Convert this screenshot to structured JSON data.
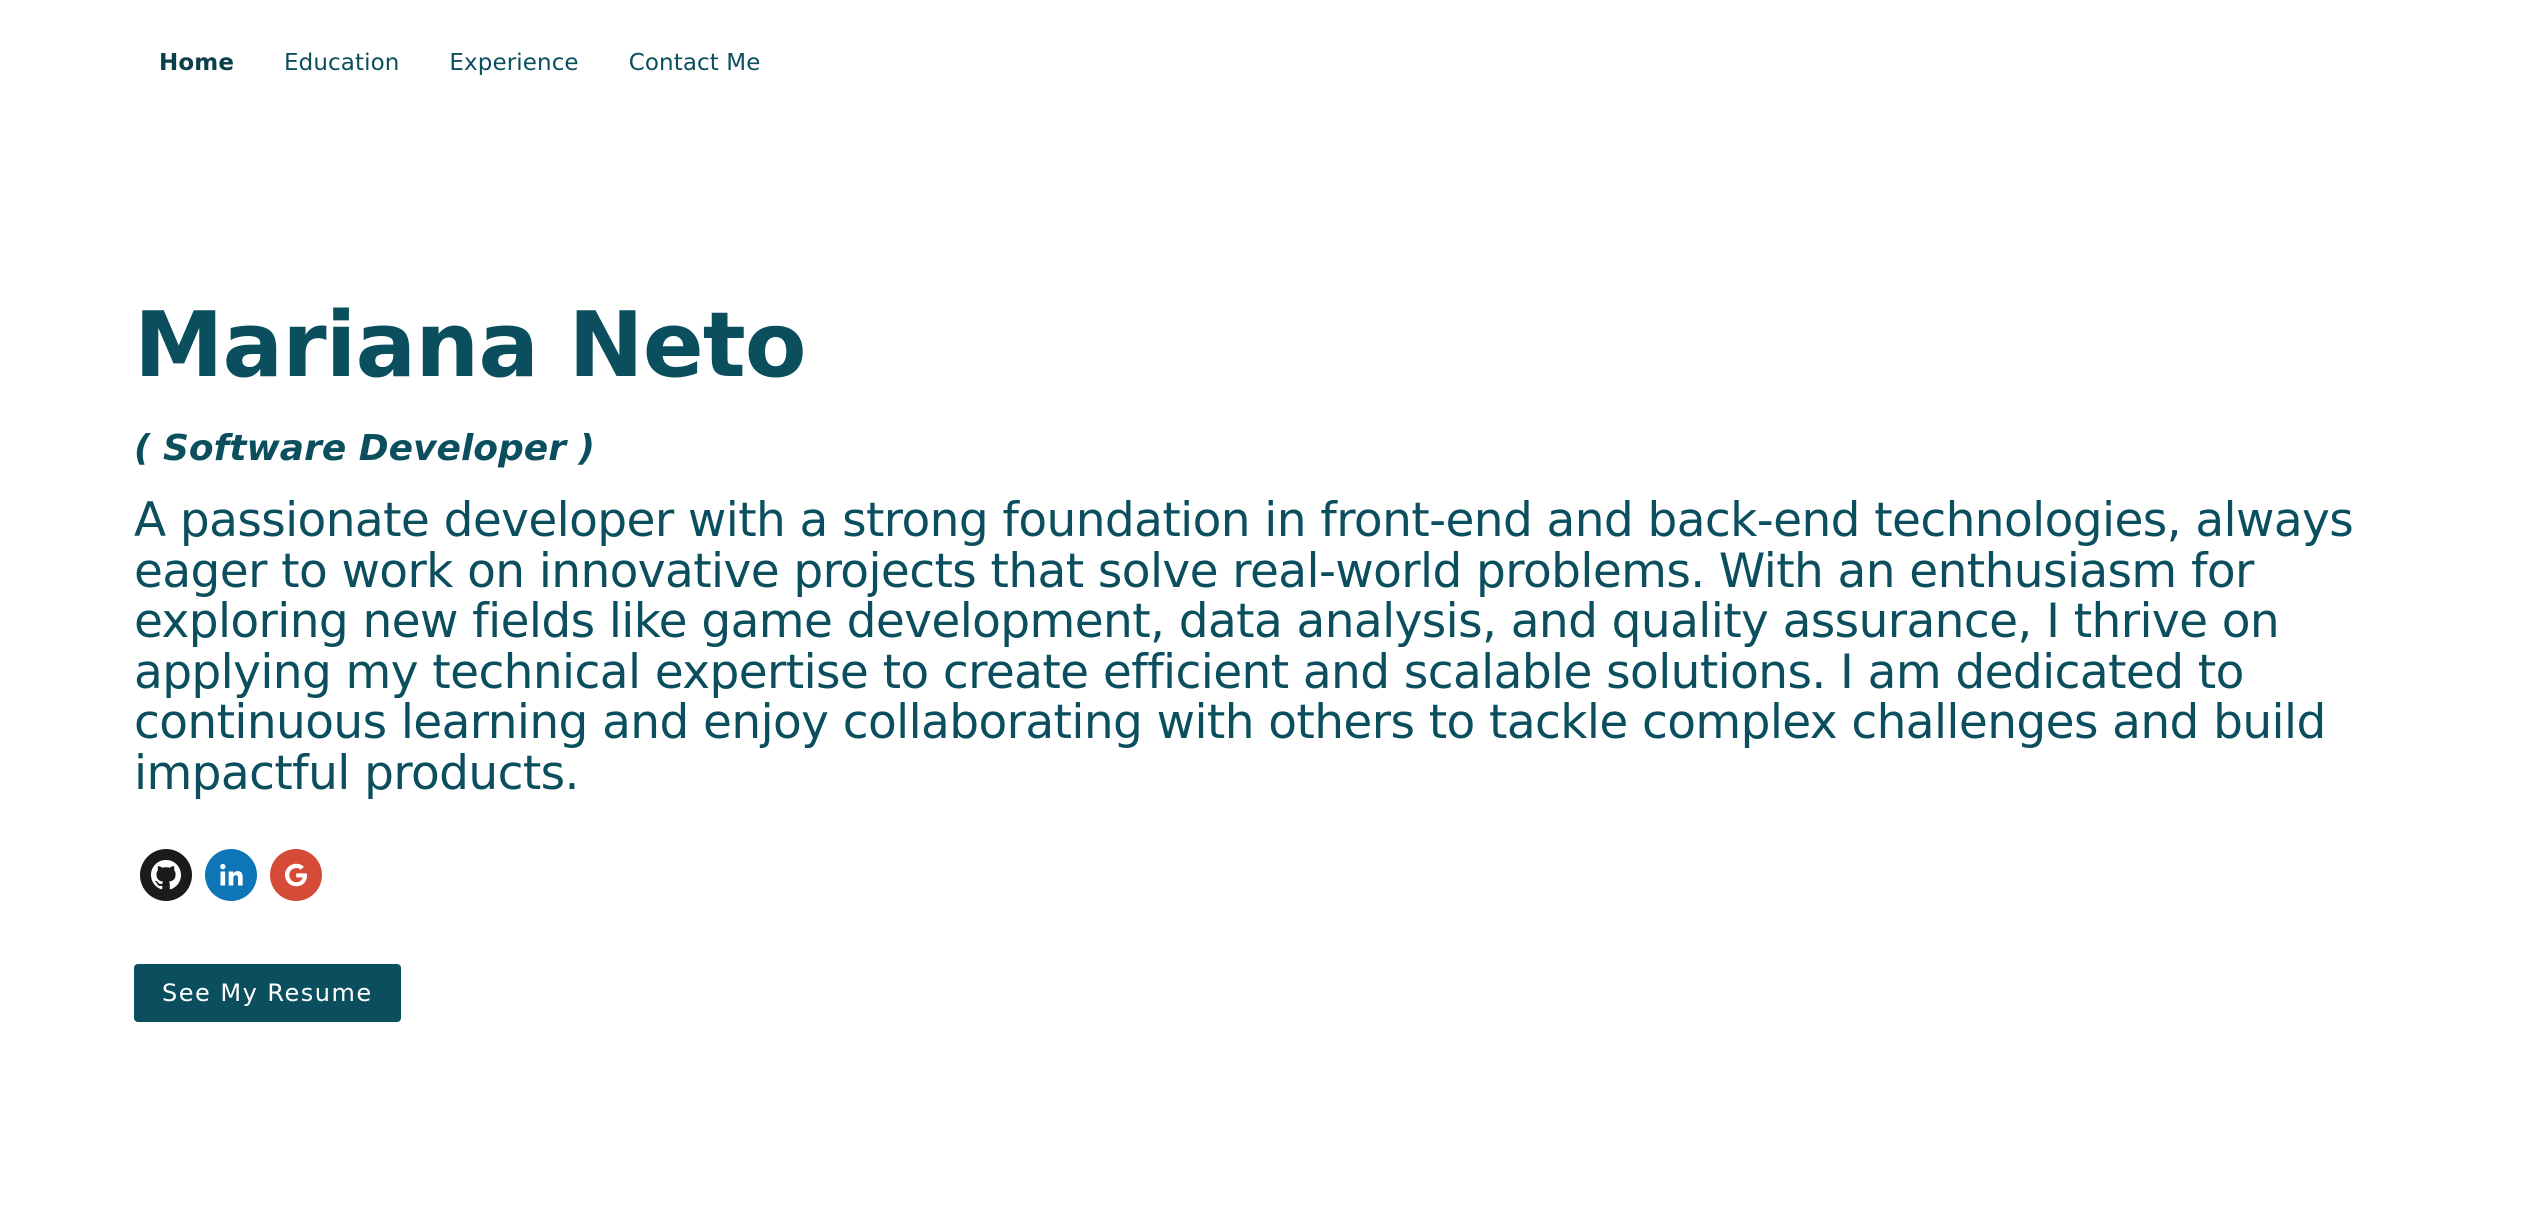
{
  "nav": {
    "items": [
      {
        "label": "Home",
        "active": true
      },
      {
        "label": "Education",
        "active": false
      },
      {
        "label": "Experience",
        "active": false
      },
      {
        "label": "Contact Me",
        "active": false
      }
    ]
  },
  "hero": {
    "name": "Mariana Neto",
    "role": "( Software Developer )",
    "bio": "A passionate developer with a strong foundation in front-end and back-end technologies, always eager to work on innovative projects that solve real-world problems. With an enthusiasm for exploring new fields like game development, data analysis, and quality assurance, I thrive on applying my technical expertise to create efficient and scalable solutions. I am dedicated to continuous learning and enjoy collaborating with others to tackle complex challenges and build impactful products.",
    "resume_button": "See My Resume"
  },
  "socials": [
    {
      "icon": "github-icon",
      "color": "#1b1b1b"
    },
    {
      "icon": "linkedin-icon",
      "color": "#0e76b6"
    },
    {
      "icon": "google-icon",
      "color": "#d64b37"
    }
  ],
  "colors": {
    "primary": "#0b4f5e",
    "background": "#ffffff"
  }
}
